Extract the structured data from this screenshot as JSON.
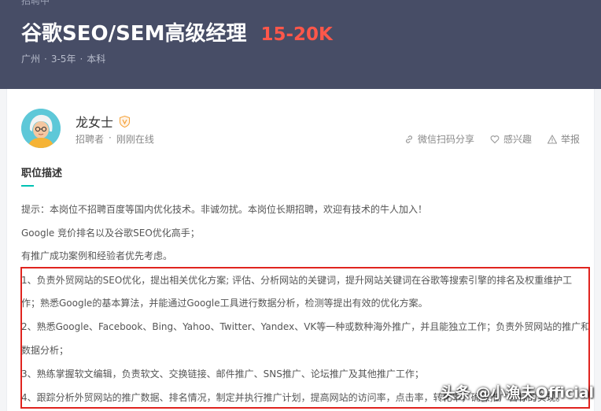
{
  "header": {
    "tag": "招聘中",
    "job_title": "谷歌SEO/SEM高级经理",
    "salary": "15-20K",
    "meta": {
      "city": "广州",
      "experience": "3-5年",
      "education": "本科",
      "separator": "·"
    }
  },
  "recruiter": {
    "name": "龙女士",
    "role": "招聘者",
    "separator": "·",
    "status": "刚刚在线",
    "verify_icon": "verified-v-icon"
  },
  "actions": {
    "share": "微信扫码分享",
    "interest": "感兴趣",
    "report": "举报"
  },
  "description": {
    "title": "职位描述",
    "lines": [
      "提示：本岗位不招聘百度等国内优化技术。非诚勿扰。本岗位长期招聘，欢迎有技术的牛人加入！",
      "Google 竞价排名以及谷歌SEO优化高手；",
      "有推广成功案例和经验者优先考虑。",
      "1、负责外贸网站的SEO优化，提出相关优化方案; 评估、分析网站的关键词，提升网站关键词在谷歌等搜索引擎的排名及权重维护工",
      "作；熟悉Google的基本算法，并能通过Google工具进行数据分析，检测等提出有效的优化方案。",
      "2、熟悉Google、Facebook、Bing、Yahoo、Twitter、Yandex、VK等一种或数种海外推广，并且能独立工作；负责外贸网站的推广和",
      "数据分析；",
      "3、熟练掌握软文编辑，负责软文、交换链接、邮件推广、SNS推广、论坛推广及其他推广工作；",
      "4、跟踪分析外贸网站的推广数据、排名情况，制定并执行推广计划，提高网站的访问率，点击率，转化率，确保推广目标的实现。"
    ]
  },
  "watermark": "头条 @小漁夫Official",
  "colors": {
    "header_bg": "#474d66",
    "salary": "#fe574a",
    "accent": "#00c2b3",
    "highlight_border": "#e0241f"
  }
}
